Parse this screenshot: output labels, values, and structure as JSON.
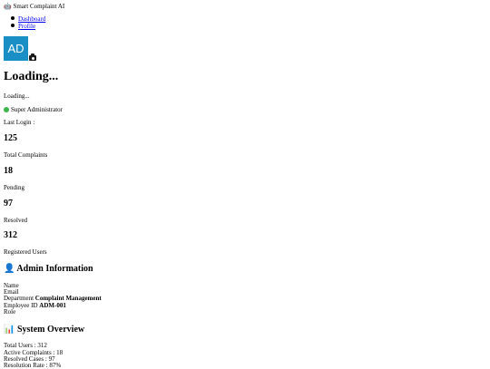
{
  "app": {
    "icon": "robot-icon",
    "title": "Smart Complaint AI"
  },
  "nav": {
    "items": [
      {
        "label": "Dashboard"
      },
      {
        "label": "Profile"
      }
    ]
  },
  "profile": {
    "avatar_initials": "AD",
    "avatar_color": "#1a8fc6",
    "name_heading": "Loading...",
    "subtitle": "Loading...",
    "status_label": "Super Administrator",
    "status_color": "#3cb54a",
    "last_login_label": "Last Login :"
  },
  "stats": [
    {
      "value": "125",
      "label": "Total Complaints"
    },
    {
      "value": "18",
      "label": "Pending"
    },
    {
      "value": "97",
      "label": "Resolved"
    },
    {
      "value": "312",
      "label": "Registered Users"
    }
  ],
  "admin_info": {
    "icon": "user-icon",
    "heading": "Admin Information",
    "name_label": "Name",
    "email_label": "Email",
    "department_label": "Department",
    "department_value": "Complaint Management",
    "employee_id_label": "Employee ID",
    "employee_id_value": "ADM-001",
    "role_label": "Role"
  },
  "system_overview": {
    "icon": "bar-chart-icon",
    "heading": "System Overview",
    "lines": [
      "Total Users : 312",
      "Active Complaints : 18",
      "Resolved Cases : 97",
      "Resolution Rate : 87%"
    ]
  }
}
